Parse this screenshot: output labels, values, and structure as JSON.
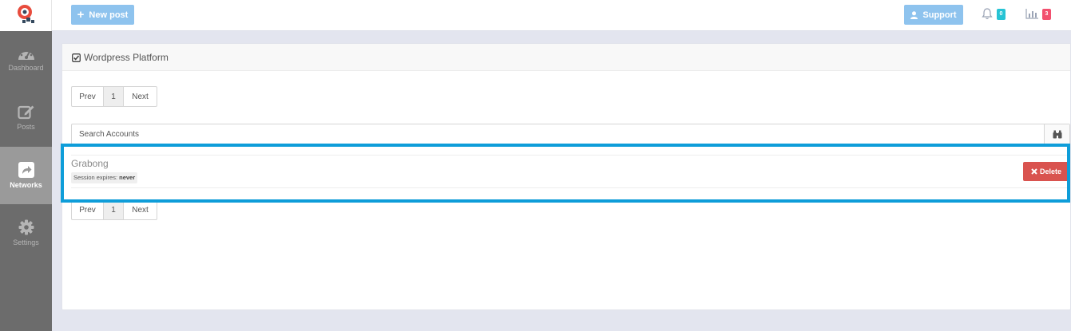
{
  "topbar": {
    "new_post_label": "New post",
    "support_label": "Support",
    "notifications_count": "0",
    "stats_count": "3",
    "accent_color": "#8ec3ee"
  },
  "sidebar": {
    "items": [
      {
        "label": "Dashboard",
        "icon": "dashboard-icon",
        "active": false
      },
      {
        "label": "Posts",
        "icon": "edit-icon",
        "active": false
      },
      {
        "label": "Networks",
        "icon": "share-icon",
        "active": true
      },
      {
        "label": "Settings",
        "icon": "gear-icon",
        "active": false
      }
    ]
  },
  "panel": {
    "title": "Wordpress Platform",
    "pagination": {
      "prev": "Prev",
      "page": "1",
      "next": "Next"
    },
    "search": {
      "placeholder": "Search Accounts",
      "value": ""
    },
    "accounts": [
      {
        "name": "Grabong",
        "session_label": "Session expires:",
        "session_value": "never",
        "delete_label": "Delete"
      }
    ]
  },
  "colors": {
    "delete": "#d9534f",
    "highlight": "#0e9dd9",
    "badge_teal": "#27c3d4",
    "badge_red": "#f2506f"
  }
}
